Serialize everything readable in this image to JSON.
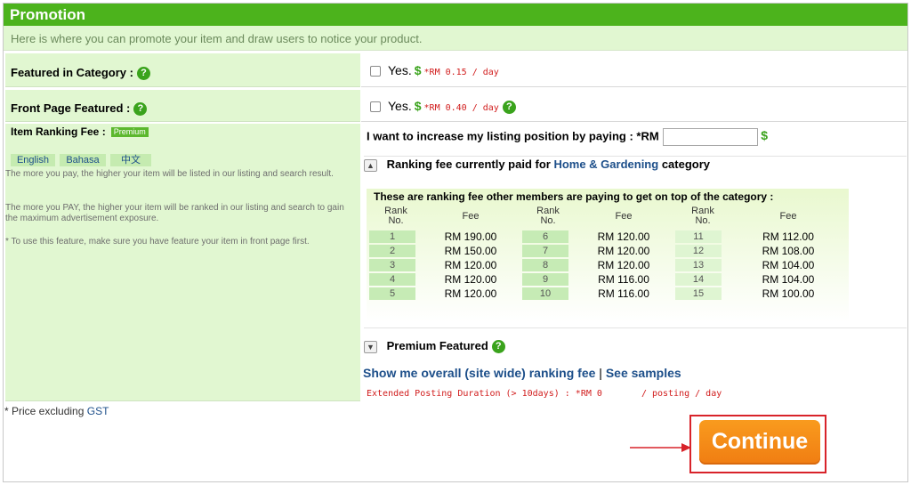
{
  "header": {
    "title": "Promotion",
    "subtitle": "Here is where you can promote your item and draw users to notice your product."
  },
  "featured_category": {
    "label": "Featured in Category :",
    "checkbox_label": "Yes.",
    "price": "*RM 0.15 / day"
  },
  "front_page": {
    "label": "Front Page Featured :",
    "checkbox_label": "Yes.",
    "price": "*RM 0.40 / day"
  },
  "ranking": {
    "label": "Item Ranking Fee :",
    "badge": "Premium",
    "languages": [
      "English",
      "Bahasa",
      "中文"
    ],
    "desc1": "The more you pay, the higher your item will be listed in our listing and search result.",
    "desc2": "The more you PAY, the higher your item will be ranked in our listing and search to gain the maximum advertisement exposure.",
    "desc3": "* To use this feature, make sure you have feature your item in front page first.",
    "increase_label": "I want to increase my listing position by paying : *RM",
    "increase_value": "",
    "category_prefix": "Ranking fee currently paid for",
    "category_name": "Home & Gardening",
    "category_suffix": "category"
  },
  "fee_table": {
    "title": "These are ranking fee other members are paying to get on top of the category :",
    "rank_header": "Rank No.",
    "fee_header": "Fee",
    "columns": [
      {
        "ranks": [
          "1",
          "2",
          "3",
          "4",
          "5"
        ],
        "fees": [
          "RM 190.00",
          "RM 150.00",
          "RM 120.00",
          "RM 120.00",
          "RM 120.00"
        ]
      },
      {
        "ranks": [
          "6",
          "7",
          "8",
          "9",
          "10"
        ],
        "fees": [
          "RM 120.00",
          "RM 120.00",
          "RM 120.00",
          "RM 116.00",
          "RM 116.00"
        ]
      },
      {
        "ranks": [
          "11",
          "12",
          "13",
          "14",
          "15"
        ],
        "fees": [
          "RM 112.00",
          "RM 108.00",
          "RM 104.00",
          "RM 104.00",
          "RM 100.00"
        ]
      }
    ]
  },
  "premium": {
    "label": "Premium Featured",
    "overall_link": "Show me overall (site wide) ranking fee",
    "separator": "|",
    "samples_link": "See samples",
    "extended": "Extended Posting Duration (> 10days) : *RM 0",
    "extended_suffix": "/ posting / day"
  },
  "footer": {
    "note_prefix": "* Price excluding",
    "note_link": "GST"
  },
  "actions": {
    "continue_label": "Continue"
  },
  "colors": {
    "header_green": "#4cb31c",
    "accent_orange": "#f07d12",
    "price_red": "#d11c1c",
    "highlight_red": "#d8232a"
  }
}
